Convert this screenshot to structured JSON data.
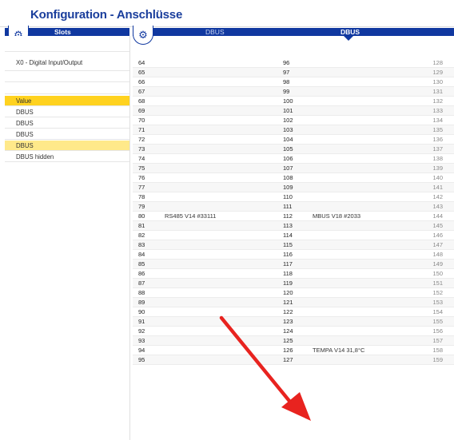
{
  "window": {
    "title": "Konfiguration - Anschlüsse"
  },
  "tabs": {
    "slots_label": "Slots",
    "dbus_inactive_label": "DBUS",
    "dbus_active_label": "DBUS"
  },
  "sidebar": {
    "module_label": "X0 - Digital Input/Output",
    "items": [
      {
        "label": "Value",
        "state": "selected"
      },
      {
        "label": "DBUS",
        "state": "normal"
      },
      {
        "label": "DBUS",
        "state": "normal"
      },
      {
        "label": "DBUS",
        "state": "normal"
      },
      {
        "label": "DBUS",
        "state": "highlight"
      },
      {
        "label": "DBUS hidden",
        "state": "normal"
      }
    ]
  },
  "grid": {
    "rows": [
      {
        "c1": "64",
        "t1": "",
        "c2": "96",
        "t2": "",
        "c3": "128"
      },
      {
        "c1": "65",
        "t1": "",
        "c2": "97",
        "t2": "",
        "c3": "129"
      },
      {
        "c1": "66",
        "t1": "",
        "c2": "98",
        "t2": "",
        "c3": "130"
      },
      {
        "c1": "67",
        "t1": "",
        "c2": "99",
        "t2": "",
        "c3": "131"
      },
      {
        "c1": "68",
        "t1": "",
        "c2": "100",
        "t2": "",
        "c3": "132"
      },
      {
        "c1": "69",
        "t1": "",
        "c2": "101",
        "t2": "",
        "c3": "133"
      },
      {
        "c1": "70",
        "t1": "",
        "c2": "102",
        "t2": "",
        "c3": "134"
      },
      {
        "c1": "71",
        "t1": "",
        "c2": "103",
        "t2": "",
        "c3": "135"
      },
      {
        "c1": "72",
        "t1": "",
        "c2": "104",
        "t2": "",
        "c3": "136"
      },
      {
        "c1": "73",
        "t1": "",
        "c2": "105",
        "t2": "",
        "c3": "137"
      },
      {
        "c1": "74",
        "t1": "",
        "c2": "106",
        "t2": "",
        "c3": "138"
      },
      {
        "c1": "75",
        "t1": "",
        "c2": "107",
        "t2": "",
        "c3": "139"
      },
      {
        "c1": "76",
        "t1": "",
        "c2": "108",
        "t2": "",
        "c3": "140"
      },
      {
        "c1": "77",
        "t1": "",
        "c2": "109",
        "t2": "",
        "c3": "141"
      },
      {
        "c1": "78",
        "t1": "",
        "c2": "110",
        "t2": "",
        "c3": "142"
      },
      {
        "c1": "79",
        "t1": "",
        "c2": "111",
        "t2": "",
        "c3": "143"
      },
      {
        "c1": "80",
        "t1": "RS485 V14 #33111",
        "c2": "112",
        "t2": "MBUS V18 #2033",
        "c3": "144"
      },
      {
        "c1": "81",
        "t1": "",
        "c2": "113",
        "t2": "",
        "c3": "145"
      },
      {
        "c1": "82",
        "t1": "",
        "c2": "114",
        "t2": "",
        "c3": "146"
      },
      {
        "c1": "83",
        "t1": "",
        "c2": "115",
        "t2": "",
        "c3": "147"
      },
      {
        "c1": "84",
        "t1": "",
        "c2": "116",
        "t2": "",
        "c3": "148"
      },
      {
        "c1": "85",
        "t1": "",
        "c2": "117",
        "t2": "",
        "c3": "149"
      },
      {
        "c1": "86",
        "t1": "",
        "c2": "118",
        "t2": "",
        "c3": "150"
      },
      {
        "c1": "87",
        "t1": "",
        "c2": "119",
        "t2": "",
        "c3": "151"
      },
      {
        "c1": "88",
        "t1": "",
        "c2": "120",
        "t2": "",
        "c3": "152"
      },
      {
        "c1": "89",
        "t1": "",
        "c2": "121",
        "t2": "",
        "c3": "153"
      },
      {
        "c1": "90",
        "t1": "",
        "c2": "122",
        "t2": "",
        "c3": "154"
      },
      {
        "c1": "91",
        "t1": "",
        "c2": "123",
        "t2": "",
        "c3": "155"
      },
      {
        "c1": "92",
        "t1": "",
        "c2": "124",
        "t2": "",
        "c3": "156"
      },
      {
        "c1": "93",
        "t1": "",
        "c2": "125",
        "t2": "",
        "c3": "157"
      },
      {
        "c1": "94",
        "t1": "",
        "c2": "126",
        "t2": "TEMPA V14 31,8°C",
        "c3": "158"
      },
      {
        "c1": "95",
        "t1": "",
        "c2": "127",
        "t2": "",
        "c3": "159"
      }
    ]
  },
  "colors": {
    "brand_blue": "#1038a0",
    "title_blue": "#1a3e9c",
    "selected_yellow": "#ffd21f",
    "highlight_yellow": "#ffe98a",
    "annotation_red": "#e8231f"
  },
  "icons": {
    "settings": "gear-icon"
  }
}
